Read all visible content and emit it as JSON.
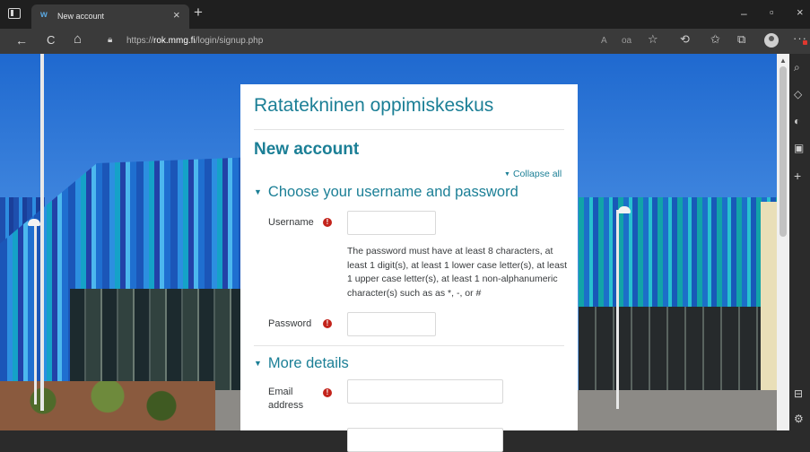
{
  "browser": {
    "tab_title": "New account",
    "tab_favicon": "w",
    "tab_close": "×",
    "new_tab": "+",
    "window_buttons": {
      "minimize": "–",
      "restore": "▫",
      "close": "×"
    },
    "nav": {
      "back": "←",
      "refresh": "C",
      "home": "⌂"
    },
    "url_prefix": "https://",
    "url_domain": "rok.mmg.fi",
    "url_path": "/login/signup.php",
    "toolbar": {
      "read_aloud": "A",
      "immersive": "oa",
      "favorite": "☆",
      "extensions": "⟲",
      "favorites": "✩",
      "collections": "⧉",
      "more": "···"
    },
    "side_panel_icons": [
      "search-icon",
      "tag-icon",
      "shield-icon",
      "office-icon",
      "plus-icon",
      "panel-icon",
      "settings-icon"
    ]
  },
  "page": {
    "site_name": "Ratatekninen oppimiskeskus",
    "title": "New account",
    "collapse_all": "Collapse all",
    "section1": {
      "legend": "Choose your username and password",
      "username_label": "Username",
      "username_value": "",
      "password_help": "The password must have at least 8 characters, at least 1 digit(s), at least 1 lower case letter(s), at least 1 upper case letter(s), at least 1 non-alphanumeric character(s) such as as *, -, or #",
      "password_label": "Password",
      "password_value": ""
    },
    "section2": {
      "legend": "More details",
      "email_label": "Email address",
      "email_value": ""
    },
    "required_mark": "!"
  },
  "colors": {
    "accent": "#1b7f96",
    "required": "#c3231b",
    "chrome_dark": "#1f1f1f",
    "chrome_nav": "#3a3a3a"
  }
}
